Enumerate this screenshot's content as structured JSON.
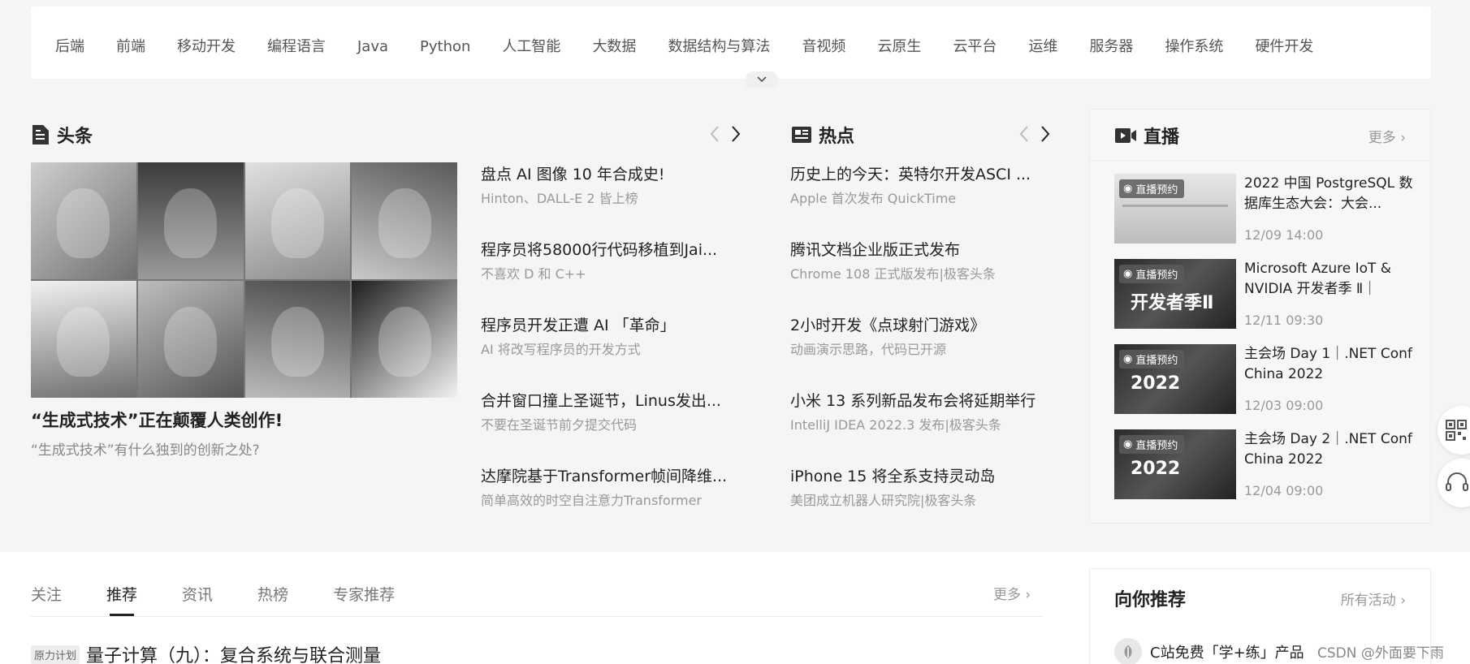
{
  "categories": [
    "后端",
    "前端",
    "移动开发",
    "编程语言",
    "Java",
    "Python",
    "人工智能",
    "大数据",
    "数据结构与算法",
    "音视频",
    "云原生",
    "云平台",
    "运维",
    "服务器",
    "操作系统",
    "硬件开发"
  ],
  "headline": {
    "section_title": "头条",
    "main_title": "“生成式技术”正在颠覆人类创作!",
    "main_subtitle": "“生成式技术”有什么独到的创新之处?",
    "items": [
      {
        "title": "盘点 AI 图像 10 年合成史!",
        "sub": "Hinton、DALL-E 2 皆上榜"
      },
      {
        "title": "程序员将58000行代码移植到Jai...",
        "sub": "不喜欢 D 和 C++"
      },
      {
        "title": "程序员开发正遭 AI 「革命」",
        "sub": " AI 将改写程序员的开发方式"
      },
      {
        "title": "合并窗口撞上圣诞节，Linus发出...",
        "sub": "不要在圣诞节前夕提交代码"
      },
      {
        "title": "达摩院基于Transformer帧间降维...",
        "sub": "简单高效的时空自注意力Transformer"
      }
    ]
  },
  "hot": {
    "section_title": "热点",
    "items": [
      {
        "title": "历史上的今天：英特尔开发ASCI ...",
        "sub": "Apple 首次发布 QuickTime"
      },
      {
        "title": "腾讯文档企业版正式发布",
        "sub": "Chrome 108 正式版发布|极客头条"
      },
      {
        "title": "2小时开发《点球射门游戏》",
        "sub": "动画演示思路，代码已开源"
      },
      {
        "title": "小米 13 系列新品发布会将延期举行",
        "sub": "IntelliJ IDEA 2022.3 发布|极客头条"
      },
      {
        "title": "iPhone 15 将全系支持灵动岛",
        "sub": "美团成立机器人研究院|极客头条"
      }
    ]
  },
  "live": {
    "section_title": "直播",
    "more": "更多",
    "badge": "直播预约",
    "items": [
      {
        "title": "2022 中国 PostgreSQL 数据库生态大会：大会...",
        "date": "12/09 14:00",
        "thumb_text": ""
      },
      {
        "title": "Microsoft Azure IoT & NVIDIA 开发者季 Ⅱ｜Azu...",
        "date": "12/11 09:30",
        "thumb_text": "开发者季Ⅱ"
      },
      {
        "title": "主会场 Day 1｜.NET Conf China 2022",
        "date": "12/03 09:00",
        "thumb_text": "2022"
      },
      {
        "title": "主会场 Day 2｜.NET Conf China 2022",
        "date": "12/04 09:00",
        "thumb_text": "2022"
      }
    ]
  },
  "feed": {
    "tabs": [
      "关注",
      "推荐",
      "资讯",
      "热榜",
      "专家推荐"
    ],
    "active_tab": "推荐",
    "more": "更多",
    "article_tag": "原力计划",
    "article_title": "量子计算（九）：复合系统与联合测量"
  },
  "recommend": {
    "title": "向你推荐",
    "more": "所有活动",
    "item": "C站免费「学+练」产品"
  },
  "watermark": "CSDN @外面要下雨"
}
